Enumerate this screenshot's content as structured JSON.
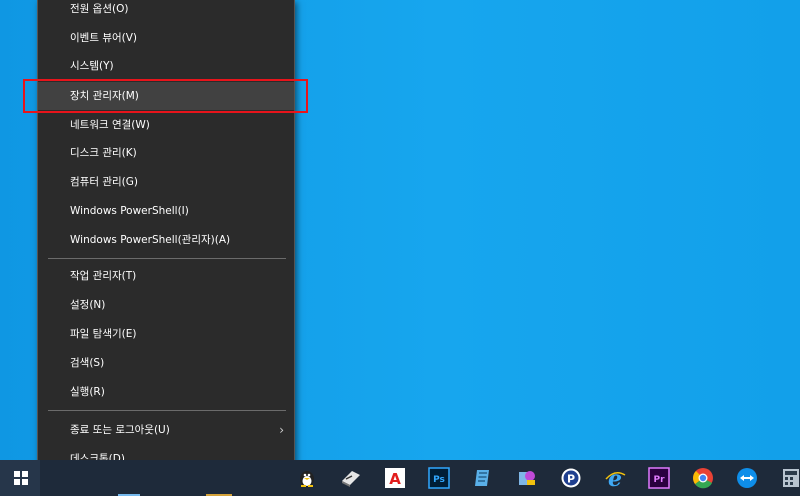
{
  "menu": {
    "group1": [
      {
        "label": "전원 옵션(O)"
      },
      {
        "label": "이벤트 뷰어(V)"
      },
      {
        "label": "시스템(Y)"
      },
      {
        "label": "장치 관리자(M)",
        "highlighted": true
      },
      {
        "label": "네트워크 연결(W)"
      },
      {
        "label": "디스크 관리(K)"
      },
      {
        "label": "컴퓨터 관리(G)"
      },
      {
        "label": "Windows PowerShell(I)"
      },
      {
        "label": "Windows PowerShell(관리자)(A)"
      }
    ],
    "group2": [
      {
        "label": "작업 관리자(T)"
      },
      {
        "label": "설정(N)"
      },
      {
        "label": "파일 탐색기(E)"
      },
      {
        "label": "검색(S)"
      },
      {
        "label": "실행(R)"
      }
    ],
    "group3": [
      {
        "label": "종료 또는 로그아웃(U)",
        "submenu": true
      },
      {
        "label": "데스크톱(D)"
      }
    ],
    "submenu_glyph": "›"
  },
  "taskbar": {
    "icons": [
      {
        "name": "penguin-icon",
        "color": "#f2c20f"
      },
      {
        "name": "scanner-icon",
        "color": "#e6e6e6"
      },
      {
        "name": "acrobat-icon",
        "color": "#e21d1d",
        "glyph": "A"
      },
      {
        "name": "photoshop-icon",
        "color": "#31a8ff",
        "glyph": "Ps"
      },
      {
        "name": "notes-icon",
        "color": "#5ab0e8"
      },
      {
        "name": "paint-icon",
        "color": "#c04ad8"
      },
      {
        "name": "p-app-icon",
        "color": "#1f6dd8",
        "glyph": "P"
      },
      {
        "name": "internet-explorer-icon",
        "color": "#3fa9f5",
        "glyph": "e"
      },
      {
        "name": "premiere-icon",
        "color": "#e07bff",
        "glyph": "Pr"
      },
      {
        "name": "chrome-icon",
        "color": "#e94235"
      },
      {
        "name": "teamviewer-icon",
        "color": "#0e8ee9"
      },
      {
        "name": "calculator-icon",
        "color": "#b8c4d0"
      }
    ]
  }
}
